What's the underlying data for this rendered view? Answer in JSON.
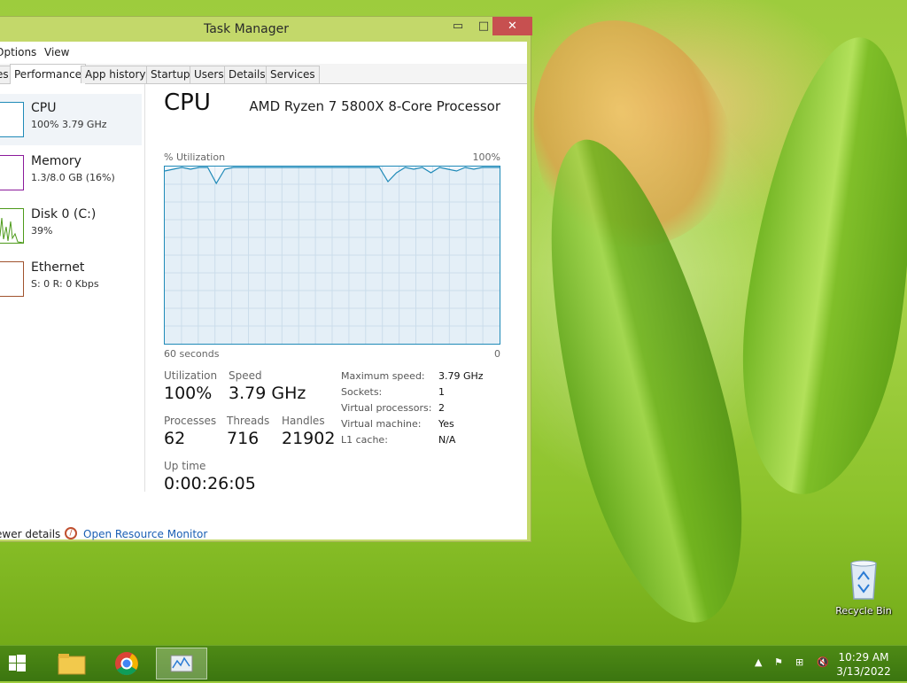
{
  "window": {
    "title": "Task Manager",
    "minimize": "▭",
    "maximize": "□",
    "close": "✕"
  },
  "menu": {
    "options": "Options",
    "view": "View"
  },
  "tabs": [
    {
      "label": "es"
    },
    {
      "label": "Performance"
    },
    {
      "label": "App history"
    },
    {
      "label": "Startup"
    },
    {
      "label": "Users"
    },
    {
      "label": "Details"
    },
    {
      "label": "Services"
    }
  ],
  "sidebar": [
    {
      "name": "CPU",
      "value": "100% 3.79 GHz",
      "color": "#1f8ab8"
    },
    {
      "name": "Memory",
      "value": "1.3/8.0 GB (16%)",
      "color": "#8b1a9b"
    },
    {
      "name": "Disk 0 (C:)",
      "value": "39%",
      "color": "#4d9a1a"
    },
    {
      "name": "Ethernet",
      "value": "S: 0 R: 0 Kbps",
      "color": "#a0522d"
    }
  ],
  "cpu": {
    "title": "CPU",
    "model": "AMD Ryzen 7 5800X 8-Core Processor",
    "util_label": "% Utilization",
    "util_max": "100%",
    "time_left": "60 seconds",
    "time_right": "0",
    "graph_color": "#1f8ab8",
    "utilization_history": [
      98,
      99,
      100,
      99,
      100,
      100,
      91,
      99,
      100,
      100,
      100,
      100,
      100,
      100,
      100,
      100,
      100,
      100,
      100,
      100,
      100,
      100,
      100,
      100,
      100,
      100,
      92,
      97,
      100,
      99,
      100,
      97,
      100,
      99,
      98,
      100,
      99,
      100,
      100,
      100
    ],
    "stats": {
      "utilization_label": "Utilization",
      "utilization": "100%",
      "speed_label": "Speed",
      "speed": "3.79 GHz",
      "processes_label": "Processes",
      "processes": "62",
      "threads_label": "Threads",
      "threads": "716",
      "handles_label": "Handles",
      "handles": "21902",
      "uptime_label": "Up time",
      "uptime": "0:00:26:05"
    },
    "details": [
      {
        "label": "Maximum speed:",
        "value": "3.79 GHz"
      },
      {
        "label": "Sockets:",
        "value": "1"
      },
      {
        "label": "Virtual processors:",
        "value": "2"
      },
      {
        "label": "Virtual machine:",
        "value": "Yes"
      },
      {
        "label": "L1 cache:",
        "value": "N/A"
      }
    ]
  },
  "footer": {
    "fewer_details": "ewer details",
    "resource_monitor": "Open Resource Monitor"
  },
  "desktop": {
    "recycle_bin": "Recycle Bin"
  },
  "taskbar": {
    "time": "10:29 AM",
    "date": "3/13/2022"
  }
}
